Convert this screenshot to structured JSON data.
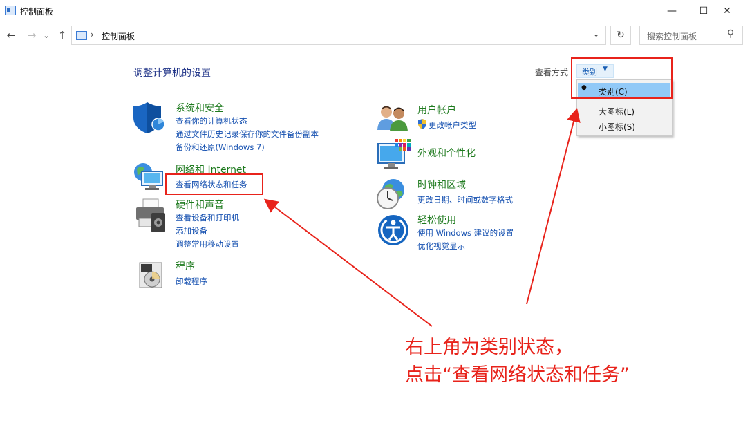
{
  "window": {
    "title": "控制面板",
    "minimize_icon": "—",
    "maximize_icon": "☐",
    "close_icon": "✕"
  },
  "nav": {
    "back_icon": "←",
    "forward_icon": "→",
    "recent_icon": "⌄",
    "up_icon": "↑"
  },
  "address": {
    "separator": "›",
    "path": "控制面板",
    "dropdown_icon": "⌄",
    "refresh_icon": "↻"
  },
  "search": {
    "placeholder": "搜索控制面板",
    "icon": "⚲"
  },
  "main": {
    "heading": "调整计算机的设置",
    "view_by_label": "查看方式",
    "view_by_value": "类别",
    "view_by_arrow": "▼"
  },
  "categories": [
    {
      "title": "系统和安全",
      "icon": "shield-icon",
      "links": [
        "查看你的计算机状态",
        "通过文件历史记录保存你的文件备份副本",
        "备份和还原(Windows 7)"
      ]
    },
    {
      "title": "网络和 Internet",
      "icon": "network-globe-icon",
      "links": [
        "查看网络状态和任务"
      ]
    },
    {
      "title": "硬件和声音",
      "icon": "printer-icon",
      "links": [
        "查看设备和打印机",
        "添加设备",
        "调整常用移动设置"
      ]
    },
    {
      "title": "程序",
      "icon": "program-disc-icon",
      "links": [
        "卸载程序"
      ]
    },
    {
      "title": "用户帐户",
      "icon": "users-icon",
      "links": [
        "更改帐户类型"
      ]
    },
    {
      "title": "外观和个性化",
      "icon": "monitor-palette-icon",
      "links": []
    },
    {
      "title": "时钟和区域",
      "icon": "clock-globe-icon",
      "links": [
        "更改日期、时间或数字格式"
      ]
    },
    {
      "title": "轻松使用",
      "icon": "accessibility-icon",
      "links": [
        "使用 Windows 建议的设置",
        "优化视觉显示"
      ]
    }
  ],
  "view_menu": {
    "items": [
      {
        "label": "类别(C)",
        "selected": true
      },
      {
        "label": "大图标(L)",
        "selected": false
      },
      {
        "label": "小图标(S)",
        "selected": false
      }
    ],
    "bullet": "●"
  },
  "annotation": {
    "line1": "右上角为类别状态，",
    "line2": "点击“查看网络状态和任务”",
    "color": "#e8231b"
  },
  "colors": {
    "link": "#1550b0",
    "category_title": "#1e7a1e",
    "heading": "#1e3287",
    "menu_highlight": "#91c9f7"
  }
}
